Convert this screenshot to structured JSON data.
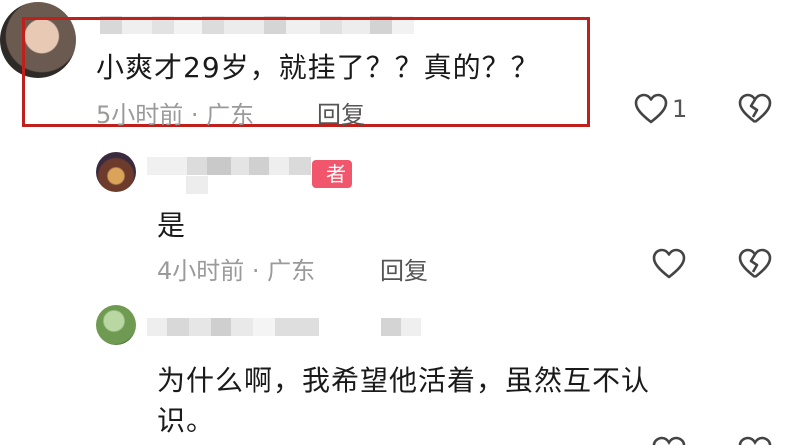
{
  "comments": [
    {
      "text": "小爽才29岁，就挂了？？真的？？",
      "time": "5小时前 · 广东",
      "reply_label": "回复",
      "like_count": "1"
    },
    {
      "text": "是",
      "badge": "者",
      "time": "4小时前 · 广东",
      "reply_label": "回复"
    },
    {
      "text_line1": "为什么啊，我希望他活着，虽然互不认",
      "text_line2": "识。"
    }
  ],
  "colors": {
    "highlight_border": "#c0201c",
    "badge_bg": "#f2566c",
    "meta_text": "#9a9a9a"
  },
  "icons": [
    "heart-outline-icon",
    "broken-heart-icon"
  ]
}
